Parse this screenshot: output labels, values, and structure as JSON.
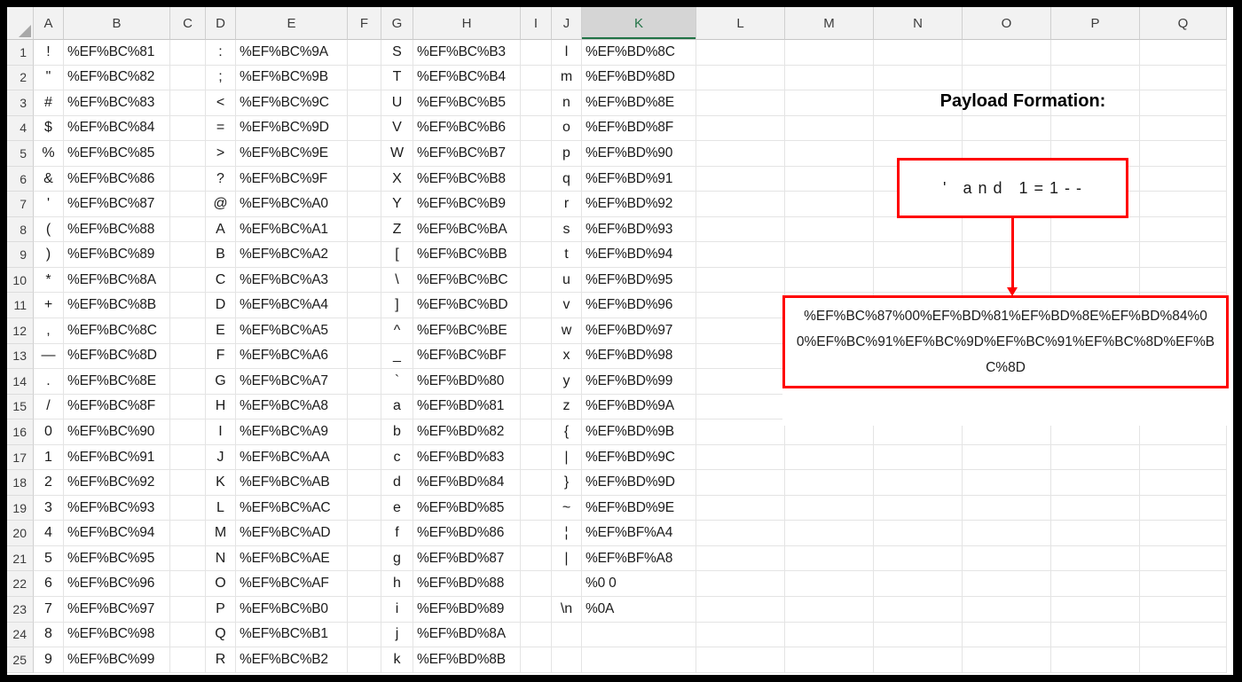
{
  "sheet": {
    "column_headers": [
      "A",
      "B",
      "C",
      "D",
      "E",
      "F",
      "G",
      "H",
      "I",
      "J",
      "K",
      "L",
      "M",
      "N",
      "O",
      "P",
      "Q"
    ],
    "selected_column": "K",
    "visible_row_count": 25,
    "rows": [
      {
        "n": 1,
        "A": "!",
        "B": "%EF%BC%81",
        "D": ":",
        "E": "%EF%BC%9A",
        "G": "S",
        "H": "%EF%BC%B3",
        "J": "l",
        "K": "%EF%BD%8C"
      },
      {
        "n": 2,
        "A": "\"",
        "B": "%EF%BC%82",
        "D": ";",
        "E": "%EF%BC%9B",
        "G": "T",
        "H": "%EF%BC%B4",
        "J": "m",
        "K": "%EF%BD%8D"
      },
      {
        "n": 3,
        "A": "#",
        "B": "%EF%BC%83",
        "D": "<",
        "E": "%EF%BC%9C",
        "G": "U",
        "H": "%EF%BC%B5",
        "J": "n",
        "K": "%EF%BD%8E"
      },
      {
        "n": 4,
        "A": "$",
        "B": "%EF%BC%84",
        "D": "=",
        "E": "%EF%BC%9D",
        "G": "V",
        "H": "%EF%BC%B6",
        "J": "o",
        "K": "%EF%BD%8F"
      },
      {
        "n": 5,
        "A": "%",
        "B": "%EF%BC%85",
        "D": ">",
        "E": "%EF%BC%9E",
        "G": "W",
        "H": "%EF%BC%B7",
        "J": "p",
        "K": "%EF%BD%90"
      },
      {
        "n": 6,
        "A": "&",
        "B": "%EF%BC%86",
        "D": "?",
        "E": "%EF%BC%9F",
        "G": "X",
        "H": "%EF%BC%B8",
        "J": "q",
        "K": "%EF%BD%91"
      },
      {
        "n": 7,
        "A": "'",
        "B": "%EF%BC%87",
        "D": "@",
        "E": "%EF%BC%A0",
        "G": "Y",
        "H": "%EF%BC%B9",
        "J": "r",
        "K": "%EF%BD%92"
      },
      {
        "n": 8,
        "A": "(",
        "B": "%EF%BC%88",
        "D": "A",
        "E": "%EF%BC%A1",
        "G": "Z",
        "H": "%EF%BC%BA",
        "J": "s",
        "K": "%EF%BD%93"
      },
      {
        "n": 9,
        "A": ")",
        "B": "%EF%BC%89",
        "D": "B",
        "E": "%EF%BC%A2",
        "G": "[",
        "H": "%EF%BC%BB",
        "J": "t",
        "K": "%EF%BD%94"
      },
      {
        "n": 10,
        "A": "*",
        "B": "%EF%BC%8A",
        "D": "C",
        "E": "%EF%BC%A3",
        "G": "\\",
        "H": "%EF%BC%BC",
        "J": "u",
        "K": "%EF%BD%95"
      },
      {
        "n": 11,
        "A": "+",
        "B": "%EF%BC%8B",
        "D": "D",
        "E": "%EF%BC%A4",
        "G": "]",
        "H": "%EF%BC%BD",
        "J": "v",
        "K": "%EF%BD%96"
      },
      {
        "n": 12,
        "A": ",",
        "B": "%EF%BC%8C",
        "D": "E",
        "E": "%EF%BC%A5",
        "G": "^",
        "H": "%EF%BC%BE",
        "J": "w",
        "K": "%EF%BD%97"
      },
      {
        "n": 13,
        "A": "—",
        "B": "%EF%BC%8D",
        "D": "F",
        "E": "%EF%BC%A6",
        "G": "_",
        "H": "%EF%BC%BF",
        "J": "x",
        "K": "%EF%BD%98"
      },
      {
        "n": 14,
        "A": ".",
        "B": "%EF%BC%8E",
        "D": "G",
        "E": "%EF%BC%A7",
        "G": "`",
        "H": "%EF%BD%80",
        "J": "y",
        "K": "%EF%BD%99"
      },
      {
        "n": 15,
        "A": "/",
        "B": "%EF%BC%8F",
        "D": "H",
        "E": "%EF%BC%A8",
        "G": "a",
        "H": "%EF%BD%81",
        "J": "z",
        "K": "%EF%BD%9A"
      },
      {
        "n": 16,
        "A": "0",
        "B": "%EF%BC%90",
        "D": "I",
        "E": "%EF%BC%A9",
        "G": "b",
        "H": "%EF%BD%82",
        "J": "{",
        "K": "%EF%BD%9B"
      },
      {
        "n": 17,
        "A": "1",
        "B": "%EF%BC%91",
        "D": "J",
        "E": "%EF%BC%AA",
        "G": "c",
        "H": "%EF%BD%83",
        "J": "|",
        "K": "%EF%BD%9C"
      },
      {
        "n": 18,
        "A": "2",
        "B": "%EF%BC%92",
        "D": "K",
        "E": "%EF%BC%AB",
        "G": "d",
        "H": "%EF%BD%84",
        "J": "}",
        "K": "%EF%BD%9D"
      },
      {
        "n": 19,
        "A": "3",
        "B": "%EF%BC%93",
        "D": "L",
        "E": "%EF%BC%AC",
        "G": "e",
        "H": "%EF%BD%85",
        "J": "~",
        "K": "%EF%BD%9E"
      },
      {
        "n": 20,
        "A": "4",
        "B": "%EF%BC%94",
        "D": "M",
        "E": "%EF%BC%AD",
        "G": "f",
        "H": "%EF%BD%86",
        "J": "¦",
        "K": "%EF%BF%A4"
      },
      {
        "n": 21,
        "A": "5",
        "B": "%EF%BC%95",
        "D": "N",
        "E": "%EF%BC%AE",
        "G": "g",
        "H": "%EF%BD%87",
        "J": "|",
        "K": "%EF%BF%A8"
      },
      {
        "n": 22,
        "A": "6",
        "B": "%EF%BC%96",
        "D": "O",
        "E": "%EF%BC%AF",
        "G": "h",
        "H": "%EF%BD%88",
        "J": "",
        "K": "%0 0"
      },
      {
        "n": 23,
        "A": "7",
        "B": "%EF%BC%97",
        "D": "P",
        "E": "%EF%BC%B0",
        "G": "i",
        "H": "%EF%BD%89",
        "J": "\\n",
        "K": "%0A"
      },
      {
        "n": 24,
        "A": "8",
        "B": "%EF%BC%98",
        "D": "Q",
        "E": "%EF%BC%B1",
        "G": "j",
        "H": "%EF%BD%8A",
        "J": "",
        "K": ""
      },
      {
        "n": 25,
        "A": "9",
        "B": "%EF%BC%99",
        "D": "R",
        "E": "%EF%BC%B2",
        "G": "k",
        "H": "%EF%BD%8B",
        "J": "",
        "K": ""
      }
    ]
  },
  "annotation": {
    "title": "Payload Formation:",
    "payload_plain": "' and 1=1--",
    "payload_encoded": "%EF%BC%87%00%EF%BD%81%EF%BD%8E%EF%BD%84%00%EF%BC%91%EF%BC%9D%EF%BC%91%EF%BC%8D%EF%BC%8D",
    "accent_red": "#FF0000",
    "selection_green": "#217346"
  }
}
